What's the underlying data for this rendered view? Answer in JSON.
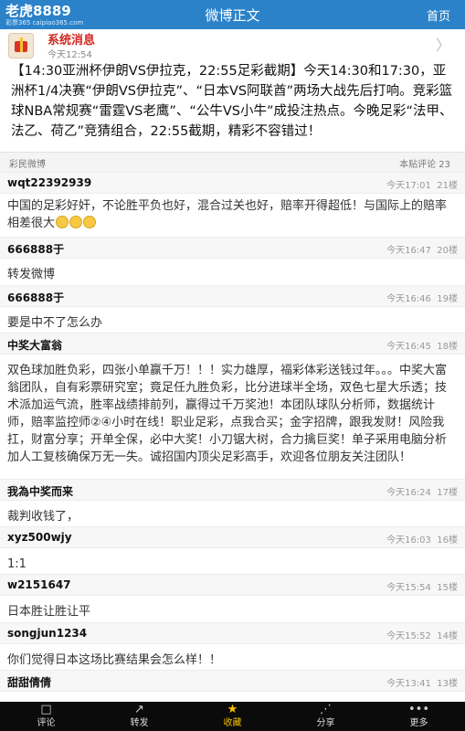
{
  "header": {
    "brand": "老虎8889",
    "brand_sub": "彩票365 caipiao365.com",
    "title": "微博正文",
    "home_label": "首页"
  },
  "message": {
    "name": "系统消息",
    "time": "今天12:54",
    "body": "【14:30亚洲杯伊朗VS伊拉克，22:55足彩截期】今天14:30和17:30，亚洲杯1/4决赛“伊朗VS伊拉克”、“日本VS阿联酋”两场大战先后打响。竞彩篮球NBA常规赛“雷霆VS老鹰”、“公牛VS小牛”成投注热点。今晚足彩“法甲、法乙、荷乙”竞猜组合，22:55截期，精彩不容错过！"
  },
  "comments_bar": {
    "source": "彩民微博",
    "count": "本贴评论 23"
  },
  "comments": [
    {
      "user": "wqt22392939",
      "time": "今天17:01",
      "floor": "21楼",
      "text": "中国的足彩好奸，不论胜平负也好，混合过关也好，赔率开得超低！与国际上的赔率相差很大",
      "emoji_count": 3
    },
    {
      "user": "666888于",
      "time": "今天16:47",
      "floor": "20楼",
      "text": "转发微博"
    },
    {
      "user": "666888于",
      "time": "今天16:46",
      "floor": "19楼",
      "text": "要是中不了怎么办"
    },
    {
      "user": "中奖大富翁",
      "time": "今天16:45",
      "floor": "18楼",
      "text": "双色球加胜负彩，四张小单赢千万！！！实力雄厚，福彩体彩送钱过年。。。中奖大富翁团队，自有彩票研究室；竟足任九胜负彩，比分进球半全场，双色七星大乐透；技术派加运气流，胜率战绩排前列，赢得过千万奖池！本团队球队分析师，数据统计师，赔率监控师②④小时在线！职业足彩，点我合买；金字招牌，跟我发财！风险我扛，财富分享；开单全保，必中大奖！小刀锯大树，合力擒巨奖！单子采用电脑分析加人工复核确保万无一失。诚招国内顶尖足彩高手，欢迎各位朋友关注团队！"
    },
    {
      "user": "我為中奖而来",
      "time": "今天16:24",
      "floor": "17楼",
      "text": "裁判收钱了，"
    },
    {
      "user": "xyz500wjy",
      "time": "今天16:03",
      "floor": "16楼",
      "text": "1:1"
    },
    {
      "user": "w2151647",
      "time": "今天15:54",
      "floor": "15楼",
      "text": "日本胜让胜让平"
    },
    {
      "user": "songjun1234",
      "time": "今天15:52",
      "floor": "14楼",
      "text": "你们觉得日本这场比赛结果会怎么样！！"
    },
    {
      "user": "甜甜倩倩",
      "time": "今天13:41",
      "floor": "13楼",
      "text": ""
    }
  ],
  "bottom_tabs": [
    {
      "label": "评论",
      "icon": "comment-icon"
    },
    {
      "label": "转发",
      "icon": "forward-icon"
    },
    {
      "label": "收藏",
      "icon": "star-icon"
    },
    {
      "label": "分享",
      "icon": "share-icon"
    },
    {
      "label": "更多",
      "icon": "more-icon"
    }
  ]
}
